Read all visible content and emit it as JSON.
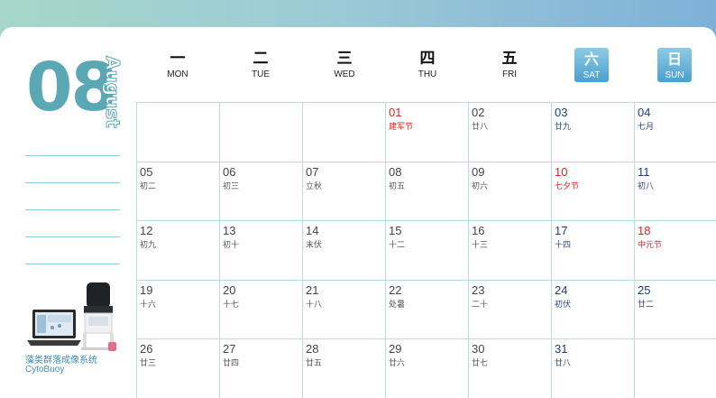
{
  "month": {
    "number": "08",
    "name": "August"
  },
  "product": {
    "caption_cn": "藻类群落成像系统",
    "caption_en": "CytoBuoy"
  },
  "weekdays": [
    {
      "cn": "一",
      "en": "MON"
    },
    {
      "cn": "二",
      "en": "TUE"
    },
    {
      "cn": "三",
      "en": "WED"
    },
    {
      "cn": "四",
      "en": "THU"
    },
    {
      "cn": "五",
      "en": "FRI"
    },
    {
      "cn": "六",
      "en": "SAT"
    },
    {
      "cn": "日",
      "en": "SUN"
    }
  ],
  "colors": {
    "accent_teal": "#5aa8b3",
    "weekend": "#1d3e7e",
    "holiday": "#e02020",
    "grid": "#b9dbe6"
  },
  "weeks": [
    [
      {
        "day": "",
        "lunar": "",
        "style": ""
      },
      {
        "day": "",
        "lunar": "",
        "style": ""
      },
      {
        "day": "",
        "lunar": "",
        "style": ""
      },
      {
        "day": "01",
        "lunar": "建军节",
        "style": "red"
      },
      {
        "day": "02",
        "lunar": "廿八",
        "style": ""
      },
      {
        "day": "03",
        "lunar": "廿九",
        "style": "blue"
      },
      {
        "day": "04",
        "lunar": "七月",
        "style": "blue"
      }
    ],
    [
      {
        "day": "05",
        "lunar": "初二",
        "style": ""
      },
      {
        "day": "06",
        "lunar": "初三",
        "style": ""
      },
      {
        "day": "07",
        "lunar": "立秋",
        "style": ""
      },
      {
        "day": "08",
        "lunar": "初五",
        "style": ""
      },
      {
        "day": "09",
        "lunar": "初六",
        "style": ""
      },
      {
        "day": "10",
        "lunar": "七夕节",
        "style": "red"
      },
      {
        "day": "11",
        "lunar": "初八",
        "style": "blue"
      }
    ],
    [
      {
        "day": "12",
        "lunar": "初九",
        "style": ""
      },
      {
        "day": "13",
        "lunar": "初十",
        "style": ""
      },
      {
        "day": "14",
        "lunar": "末伏",
        "style": ""
      },
      {
        "day": "15",
        "lunar": "十二",
        "style": ""
      },
      {
        "day": "16",
        "lunar": "十三",
        "style": ""
      },
      {
        "day": "17",
        "lunar": "十四",
        "style": "blue"
      },
      {
        "day": "18",
        "lunar": "中元节",
        "style": "red"
      }
    ],
    [
      {
        "day": "19",
        "lunar": "十六",
        "style": ""
      },
      {
        "day": "20",
        "lunar": "十七",
        "style": ""
      },
      {
        "day": "21",
        "lunar": "十八",
        "style": ""
      },
      {
        "day": "22",
        "lunar": "处暑",
        "style": ""
      },
      {
        "day": "23",
        "lunar": "二十",
        "style": ""
      },
      {
        "day": "24",
        "lunar": "初伏",
        "style": "blue"
      },
      {
        "day": "25",
        "lunar": "廿二",
        "style": "blue"
      }
    ],
    [
      {
        "day": "26",
        "lunar": "廿三",
        "style": ""
      },
      {
        "day": "27",
        "lunar": "廿四",
        "style": ""
      },
      {
        "day": "28",
        "lunar": "廿五",
        "style": ""
      },
      {
        "day": "29",
        "lunar": "廿六",
        "style": ""
      },
      {
        "day": "30",
        "lunar": "廿七",
        "style": ""
      },
      {
        "day": "31",
        "lunar": "廿八",
        "style": "blue"
      },
      {
        "day": "",
        "lunar": "",
        "style": ""
      }
    ]
  ]
}
